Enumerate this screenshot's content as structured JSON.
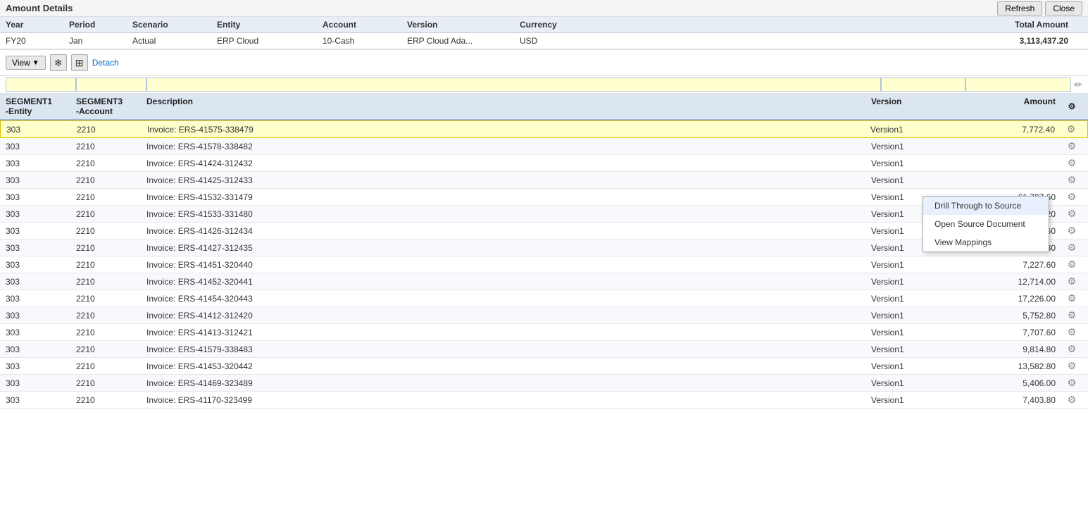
{
  "header": {
    "title": "Amount Details",
    "refresh_label": "Refresh",
    "close_label": "Close"
  },
  "summary": {
    "columns": [
      "Year",
      "Period",
      "Scenario",
      "Entity",
      "Account",
      "Version",
      "Currency",
      "Total Amount"
    ],
    "row": {
      "year": "FY20",
      "period": "Jan",
      "scenario": "Actual",
      "entity": "ERP Cloud",
      "account": "10-Cash",
      "version": "ERP Cloud Ada...",
      "currency": "USD",
      "total_amount": "3,113,437.20"
    }
  },
  "toolbar": {
    "view_label": "View",
    "detach_label": "Detach"
  },
  "table": {
    "columns": {
      "segment1": "SEGMENT1\n-Entity",
      "segment3": "SEGMENT3\n-Account",
      "description": "Description",
      "version": "Version",
      "amount": "Amount"
    },
    "rows": [
      {
        "seg1": "303",
        "seg3": "2210",
        "desc": "Invoice: ERS-41575-338479",
        "version": "Version1",
        "amount": "7,772.40",
        "highlighted": true
      },
      {
        "seg1": "303",
        "seg3": "2210",
        "desc": "Invoice: ERS-41578-338482",
        "version": "Version1",
        "amount": "",
        "highlighted": false
      },
      {
        "seg1": "303",
        "seg3": "2210",
        "desc": "Invoice: ERS-41424-312432",
        "version": "Version1",
        "amount": "",
        "highlighted": false
      },
      {
        "seg1": "303",
        "seg3": "2210",
        "desc": "Invoice: ERS-41425-312433",
        "version": "Version1",
        "amount": "",
        "highlighted": false
      },
      {
        "seg1": "303",
        "seg3": "2210",
        "desc": "Invoice: ERS-41532-331479",
        "version": "Version1",
        "amount": "61,797.60",
        "highlighted": false
      },
      {
        "seg1": "303",
        "seg3": "2210",
        "desc": "Invoice: ERS-41533-331480",
        "version": "Version1",
        "amount": "20,599.20",
        "highlighted": false
      },
      {
        "seg1": "303",
        "seg3": "2210",
        "desc": "Invoice: ERS-41426-312434",
        "version": "Version1",
        "amount": "7,707.60",
        "highlighted": false
      },
      {
        "seg1": "303",
        "seg3": "2210",
        "desc": "Invoice: ERS-41427-312435",
        "version": "Version1",
        "amount": "8,656.80",
        "highlighted": false
      },
      {
        "seg1": "303",
        "seg3": "2210",
        "desc": "Invoice: ERS-41451-320440",
        "version": "Version1",
        "amount": "7,227.60",
        "highlighted": false
      },
      {
        "seg1": "303",
        "seg3": "2210",
        "desc": "Invoice: ERS-41452-320441",
        "version": "Version1",
        "amount": "12,714.00",
        "highlighted": false
      },
      {
        "seg1": "303",
        "seg3": "2210",
        "desc": "Invoice: ERS-41454-320443",
        "version": "Version1",
        "amount": "17,226.00",
        "highlighted": false
      },
      {
        "seg1": "303",
        "seg3": "2210",
        "desc": "Invoice: ERS-41412-312420",
        "version": "Version1",
        "amount": "5,752.80",
        "highlighted": false
      },
      {
        "seg1": "303",
        "seg3": "2210",
        "desc": "Invoice: ERS-41413-312421",
        "version": "Version1",
        "amount": "7,707.60",
        "highlighted": false
      },
      {
        "seg1": "303",
        "seg3": "2210",
        "desc": "Invoice: ERS-41579-338483",
        "version": "Version1",
        "amount": "9,814.80",
        "highlighted": false
      },
      {
        "seg1": "303",
        "seg3": "2210",
        "desc": "Invoice: ERS-41453-320442",
        "version": "Version1",
        "amount": "13,582.80",
        "highlighted": false
      },
      {
        "seg1": "303",
        "seg3": "2210",
        "desc": "Invoice: ERS-41469-323489",
        "version": "Version1",
        "amount": "5,406.00",
        "highlighted": false
      },
      {
        "seg1": "303",
        "seg3": "2210",
        "desc": "Invoice: ERS-41170-323499",
        "version": "Version1",
        "amount": "7,403.80",
        "highlighted": false
      }
    ]
  },
  "context_menu": {
    "items": [
      {
        "label": "Drill Through to Source",
        "active": true
      },
      {
        "label": "Open Source Document",
        "active": false
      },
      {
        "label": "View Mappings",
        "active": false
      }
    ]
  },
  "icons": {
    "dropdown_arrow": "▼",
    "gear": "⚙",
    "pencil": "✏",
    "freeze": "❄",
    "detach": "⊞"
  }
}
